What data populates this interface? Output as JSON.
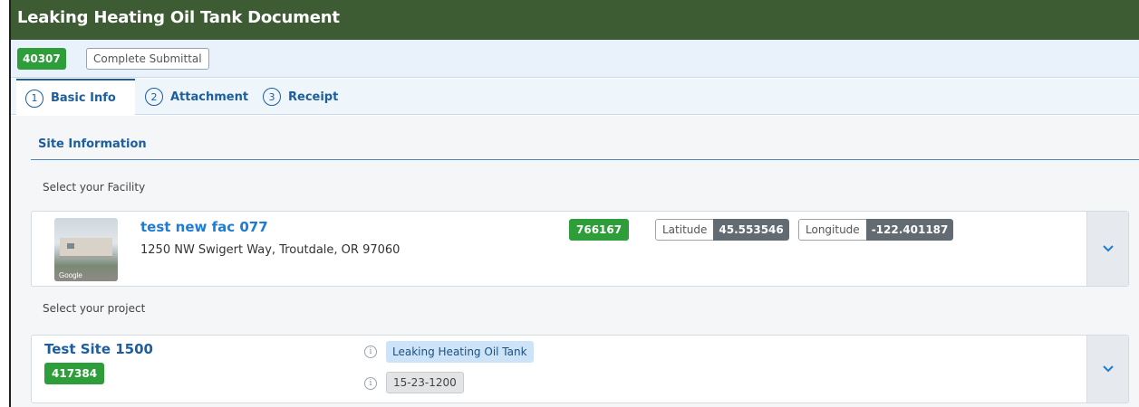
{
  "window": {
    "title": "Leaking Heating Oil Tank Document"
  },
  "status": {
    "id": "40307",
    "submittal": "Complete Submittal"
  },
  "tabs": [
    {
      "number": "1",
      "label": "Basic Info"
    },
    {
      "number": "2",
      "label": "Attachment"
    },
    {
      "number": "3",
      "label": "Receipt"
    }
  ],
  "site_section": {
    "title": "Site Information",
    "facility_prompt": "Select your Facility",
    "project_prompt": "Select your project"
  },
  "facility": {
    "name": "test new fac 077",
    "address": "1250 NW Swigert Way, Troutdale, OR 97060",
    "id": "766167",
    "latitude_label": "Latitude",
    "latitude": "45.553546",
    "longitude_label": "Longitude",
    "longitude": "-122.401187",
    "thumbnail_caption": "Google"
  },
  "project": {
    "name": "Test Site 1500",
    "id": "417384",
    "type": "Leaking Heating Oil Tank",
    "code": "15-23-1200"
  },
  "icons": {
    "expand": "chevron-down-icon",
    "info": "info-circle-icon"
  },
  "colors": {
    "title_bar": "#3e5c34",
    "accent_blue": "#1d5e9c",
    "link_blue": "#1e7bd6",
    "badge_green": "#2e9e3a",
    "coord_value": "#636b72"
  }
}
